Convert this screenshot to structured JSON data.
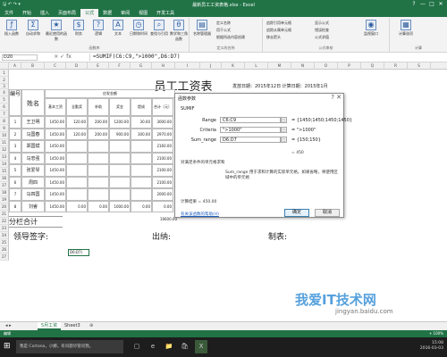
{
  "window": {
    "title": "最新员工工资表格.xlsx - Excel",
    "quick_access": "🖫 ↶ ↷ ▾",
    "controls": [
      "?",
      "—",
      "□",
      "✕"
    ]
  },
  "tabs": [
    "文件",
    "开始",
    "插入",
    "页面布局",
    "公式",
    "数据",
    "审阅",
    "视图",
    "开发工具"
  ],
  "ribbon": {
    "insert_function": "插入函数",
    "autosum": "自动求和",
    "recent": "最近使用的函数",
    "financial": "财务",
    "logical": "逻辑",
    "text": "文本",
    "datetime": "日期和时间",
    "lookup": "查找与引用",
    "math": "数学和三角函数",
    "other": "其他函数",
    "name_manager": "名称管理器",
    "define_name": "定义名称",
    "use_in_formula": "用于公式",
    "create_from_selection": "根据所选内容创建",
    "trace_precedents": "追踪引用单元格",
    "trace_dependents": "追踪从属单元格",
    "remove_arrows": "移去箭头",
    "show_formulas": "显示公式",
    "error_checking": "错误检查",
    "evaluate": "公式求值",
    "watch_window": "监视窗口",
    "calc_options": "计算选项",
    "group_labels": [
      "函数库",
      "定义的名称",
      "公式审核",
      "计算"
    ]
  },
  "formula_bar": {
    "name_box": "D20",
    "fx_icons": "× ✓ fx",
    "formula": "=SUMIF(C6:C9,\">1000\",D6:D7)"
  },
  "columns": [
    "A",
    "B",
    "C",
    "D",
    "E",
    "F",
    "G",
    "H",
    "I",
    "J",
    "K",
    "L",
    "M",
    "N",
    "O",
    "P",
    "Q",
    "R",
    "S"
  ],
  "rows": [
    "1",
    "2",
    "3",
    "4",
    "5",
    "6",
    "7",
    "8",
    "9",
    "10",
    "11",
    "12",
    "13",
    "14",
    "15",
    "16",
    "17",
    "18",
    "19",
    "20",
    "21",
    "22",
    "23",
    "24",
    "25",
    "26",
    "27"
  ],
  "sheet": {
    "title": "员工工资表",
    "date_info": "发放日期：2015年12日  计算日期：2015年1月",
    "hdr_no": "编号",
    "hdr_name": "姓名",
    "hdr_should": "应发金额",
    "hdr_sub": [
      "基本工资",
      "全勤奖",
      "补助",
      "奖金",
      "提成",
      "合计（元）"
    ],
    "employees": [
      {
        "no": "1",
        "name": "王卫明",
        "vals": [
          "1450.00",
          "120.00",
          "200.00",
          "1200.00",
          "30.00",
          "3000.00"
        ]
      },
      {
        "no": "2",
        "name": "马国春",
        "vals": [
          "1450.00",
          "120.00",
          "200.00",
          "900.00",
          "300.00",
          "2970.00"
        ]
      },
      {
        "no": "3",
        "name": "郑国斌",
        "vals": [
          "1450.00",
          "",
          "",
          "",
          "",
          "2160.00"
        ]
      },
      {
        "no": "4",
        "name": "马忠强",
        "vals": [
          "1450.00",
          "",
          "",
          "",
          "",
          "2100.00"
        ]
      },
      {
        "no": "5",
        "name": "张爱琴",
        "vals": [
          "1450.00",
          "",
          "",
          "",
          "",
          "2100.00"
        ]
      },
      {
        "no": "6",
        "name": "周四",
        "vals": [
          "1450.00",
          "",
          "",
          "",
          "",
          "2100.00"
        ]
      },
      {
        "no": "7",
        "name": "马四国",
        "vals": [
          "1450.00",
          "",
          "",
          "",
          "",
          "2000.00"
        ]
      },
      {
        "no": "8",
        "name": "刘睿",
        "vals": [
          "1450.00",
          "0.00",
          "0.00",
          "1000.00",
          "0.00",
          "0.00"
        ]
      }
    ],
    "subtotal": "分栏合计",
    "subtotal_amount": "16600.00",
    "sign_leader": "领导签字:",
    "sign_cashier": "出纳:",
    "sign_maker": "制表:",
    "cell_ref": "D6:D7)"
  },
  "dialog": {
    "title": "函数参数",
    "close": "?  ✕",
    "func_name": "SUMIF",
    "args": [
      {
        "label": "Range",
        "value": "C6:C9",
        "result": "= {1450;1450;1450;1450}"
      },
      {
        "label": "Criteria",
        "value": "\">1000\"",
        "result": "= \">1000\""
      },
      {
        "label": "Sum_range",
        "value": "D6:D7",
        "result": "= {150;150}"
      }
    ],
    "total_result": "= 450",
    "desc1": "对满足条件的单元格求和",
    "desc2": "Sum_range  用于求和计算的实际单元格。如果省略，将使用区域中的单元格",
    "calc_result": "计算结果 =  450.00",
    "help_link": "有关该函数的帮助(H)",
    "ok": "确定",
    "cancel": "取消"
  },
  "sheet_tabs": [
    "5月工资",
    "Sheet3"
  ],
  "add_sheet": "⊕",
  "status": {
    "left": "编辑",
    "right": "+  100%"
  },
  "taskbar": {
    "start": "⊞",
    "search": "我是 Cortana，小娜。有问题尽管问我。",
    "apps": [
      "▢",
      "e",
      "📁",
      "🛍",
      "X"
    ],
    "time": "15:08",
    "date": "2016-03-03"
  },
  "watermark": {
    "main": "我爱IT技术网",
    "sub": "jingyan.baidu.com"
  }
}
